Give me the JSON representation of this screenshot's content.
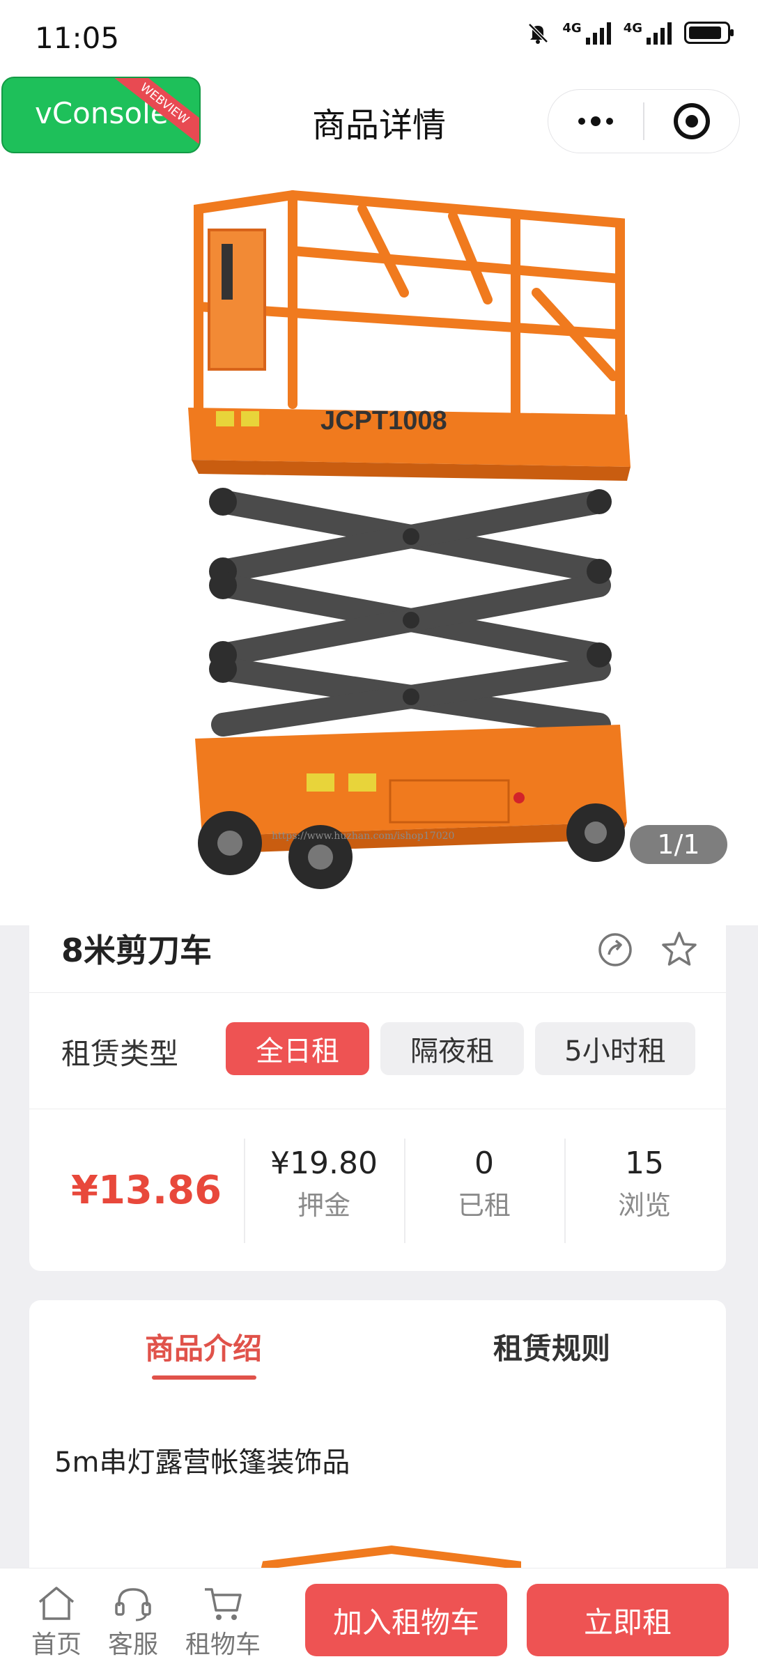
{
  "status_bar": {
    "time": "11:05",
    "network_1": "4G",
    "network_2": "4G"
  },
  "debug_badge": {
    "label": "vConsole",
    "ribbon": "WEBVIEW"
  },
  "nav": {
    "title": "商品详情"
  },
  "gallery": {
    "pager": "1/1",
    "watermark": "https://www.huzhan.com/ishop17020",
    "image_label": "JCPT1008"
  },
  "product": {
    "title": "8米剪刀车",
    "rental_type_label": "租赁类型",
    "rental_types": [
      "全日租",
      "隔夜租",
      "5小时租"
    ],
    "selected_rental_type": "全日租",
    "price": "¥13.86",
    "stats": [
      {
        "value": "¥19.80",
        "label": "押金"
      },
      {
        "value": "0",
        "label": "已租"
      },
      {
        "value": "15",
        "label": "浏览"
      }
    ]
  },
  "detail_tabs": {
    "intro": "商品介绍",
    "rules": "租赁规则",
    "active": "商品介绍"
  },
  "description": "5m串灯露营帐篷装饰品",
  "bottom_bar": {
    "home": "首页",
    "service": "客服",
    "cart": "租物车",
    "add_to_cart": "加入租物车",
    "rent_now": "立即租"
  },
  "colors": {
    "accent": "#ee5353",
    "price": "#e8483b",
    "tab_active": "#e0524a",
    "vconsole": "#1ec05a",
    "machine_orange": "#f07a1e"
  }
}
